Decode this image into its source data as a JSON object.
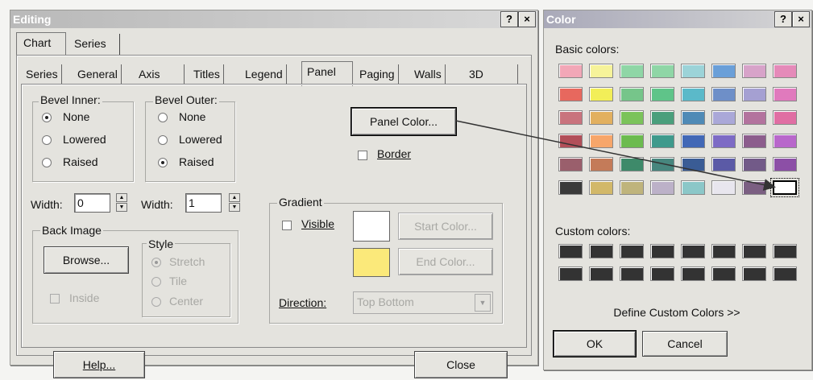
{
  "editing": {
    "title": "Editing",
    "help_glyph": "?",
    "close_glyph": "×",
    "top_tabs": [
      "Chart",
      "Series"
    ],
    "sub_tabs": [
      "Series",
      "General",
      "Axis",
      "Titles",
      "Legend",
      "Panel",
      "Paging",
      "Walls",
      "3D"
    ],
    "bevel_inner": {
      "label": "Bevel Inner:",
      "options": [
        "None",
        "Lowered",
        "Raised"
      ],
      "selected": "None"
    },
    "bevel_outer": {
      "label": "Bevel Outer:",
      "options": [
        "None",
        "Lowered",
        "Raised"
      ],
      "selected": "Raised"
    },
    "width1": {
      "label": "Width:",
      "value": "0"
    },
    "width2": {
      "label": "Width:",
      "value": "1"
    },
    "panel_color_label": "Panel Color...",
    "border_label": "Border",
    "back_image": {
      "label": "Back Image",
      "browse_label": "Browse...",
      "inside_label": "Inside"
    },
    "style": {
      "label": "Style",
      "options": [
        "Stretch",
        "Tile",
        "Center"
      ],
      "selected": "Stretch"
    },
    "gradient": {
      "label": "Gradient",
      "visible_label": "Visible",
      "start_color_label": "Start Color...",
      "end_color_label": "End Color...",
      "direction_label": "Direction:",
      "direction_value": "Top Bottom",
      "start_swatch": "#ffffff",
      "end_swatch": "#fbe97a"
    },
    "help_button": "Help...",
    "close_button": "Close"
  },
  "color_dialog": {
    "title": "Color",
    "help_glyph": "?",
    "close_glyph": "×",
    "basic_colors_label": "Basic colors:",
    "basic_colors": [
      "#f2a7b7",
      "#f6f39a",
      "#8fd6a6",
      "#8fd6a6",
      "#9cd3d8",
      "#6a9fd8",
      "#d7a3c9",
      "#e58ab9",
      "#e7685e",
      "#f2ee58",
      "#76c58a",
      "#5fc489",
      "#5bb9c9",
      "#6e8fc8",
      "#a5a0d2",
      "#e07abd",
      "#c9737d",
      "#e2b05f",
      "#7bc35a",
      "#4a9f7c",
      "#4f8ab6",
      "#aaa8d8",
      "#b3739e",
      "#e06ea3",
      "#b24f59",
      "#f7a66a",
      "#6cbb4f",
      "#3f9a8c",
      "#4268b6",
      "#7d6bc5",
      "#8c5d8d",
      "#b867cb",
      "#9a5f6c",
      "#c47b59",
      "#3e8a6a",
      "#47867e",
      "#3a5c95",
      "#5b5aa6",
      "#725a88",
      "#8c4fa6",
      "#3a3a3a",
      "#d2b869",
      "#bfb47c",
      "#bcb1c8",
      "#8bc7c8",
      "#e8e6ee",
      "#7b5f82",
      "#ffffff"
    ],
    "custom_colors_label": "Custom colors:",
    "custom_colors": [
      "#333333",
      "#333333",
      "#333333",
      "#333333",
      "#333333",
      "#333333",
      "#333333",
      "#333333",
      "#333333",
      "#333333",
      "#333333",
      "#333333",
      "#333333",
      "#333333",
      "#333333",
      "#333333"
    ],
    "define_custom_label": "Define Custom Colors >>",
    "ok_label": "OK",
    "cancel_label": "Cancel"
  }
}
